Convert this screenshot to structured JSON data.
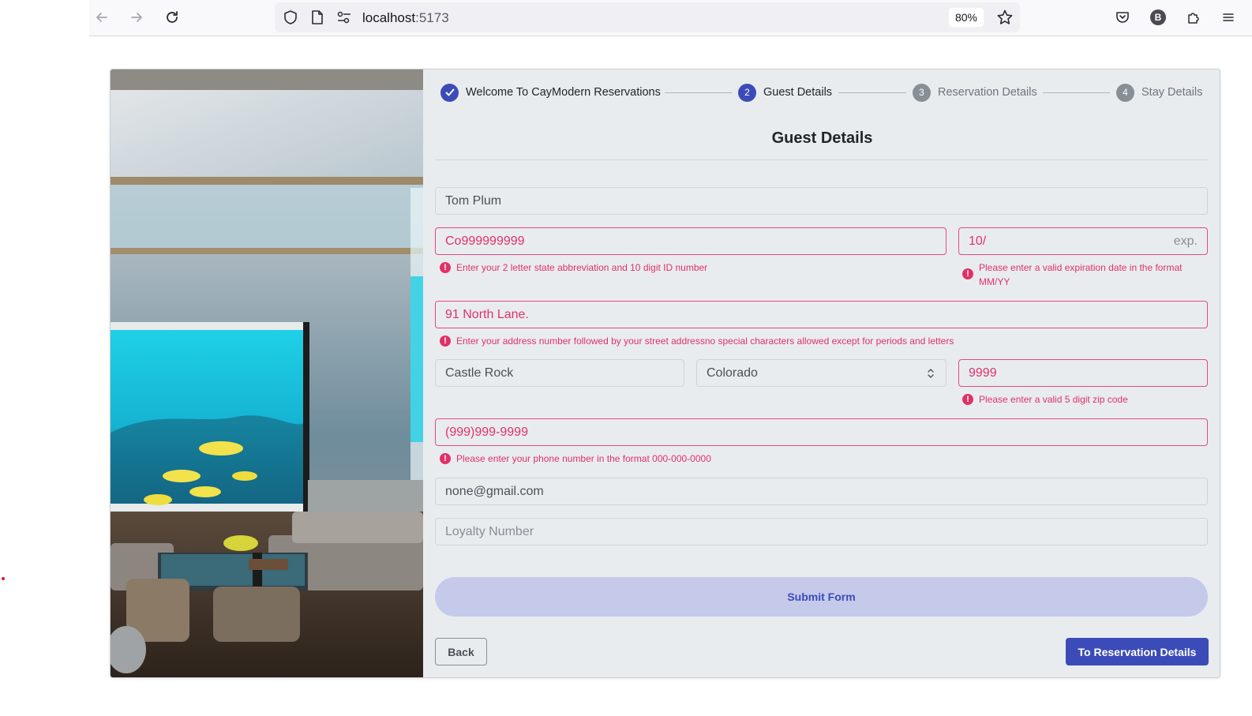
{
  "browser": {
    "url_host": "localhost",
    "url_port": ":5173",
    "zoom": "80%",
    "avatar_letter": "B"
  },
  "stepper": {
    "steps": [
      {
        "number": "1",
        "label": "Welcome To CayModern Reservations",
        "state": "done"
      },
      {
        "number": "2",
        "label": "Guest Details",
        "state": "active"
      },
      {
        "number": "3",
        "label": "Reservation Details",
        "state": "todo"
      },
      {
        "number": "4",
        "label": "Stay Details",
        "state": "todo"
      }
    ]
  },
  "form": {
    "title": "Guest Details",
    "name": {
      "value": "Tom Plum"
    },
    "id_number": {
      "value": "Co999999999",
      "error": "Enter your 2 letter state abbreviation and 10 digit ID number"
    },
    "expiration": {
      "value": "10/",
      "suffix": "exp.",
      "error": "Please enter a valid expiration date in the format MM/YY"
    },
    "address": {
      "value": "91 North Lane.",
      "error": "Enter your address number followed by your street addressno special characters allowed except for periods and letters"
    },
    "city": {
      "value": "Castle Rock"
    },
    "state": {
      "value": "Colorado"
    },
    "zip": {
      "value": "9999",
      "error": "Please enter a valid 5 digit zip code"
    },
    "phone": {
      "value": "(999)999-9999",
      "error": "Please enter your phone number in the format 000-000-0000"
    },
    "email": {
      "value": "none@gmail.com"
    },
    "loyalty": {
      "value": "",
      "placeholder": "Loyalty Number"
    },
    "submit_label": "Submit Form",
    "back_label": "Back",
    "next_label": "To Reservation Details"
  },
  "colors": {
    "accent": "#3b4cb8",
    "error": "#e03167",
    "submit_bg": "#c5c9ea"
  }
}
